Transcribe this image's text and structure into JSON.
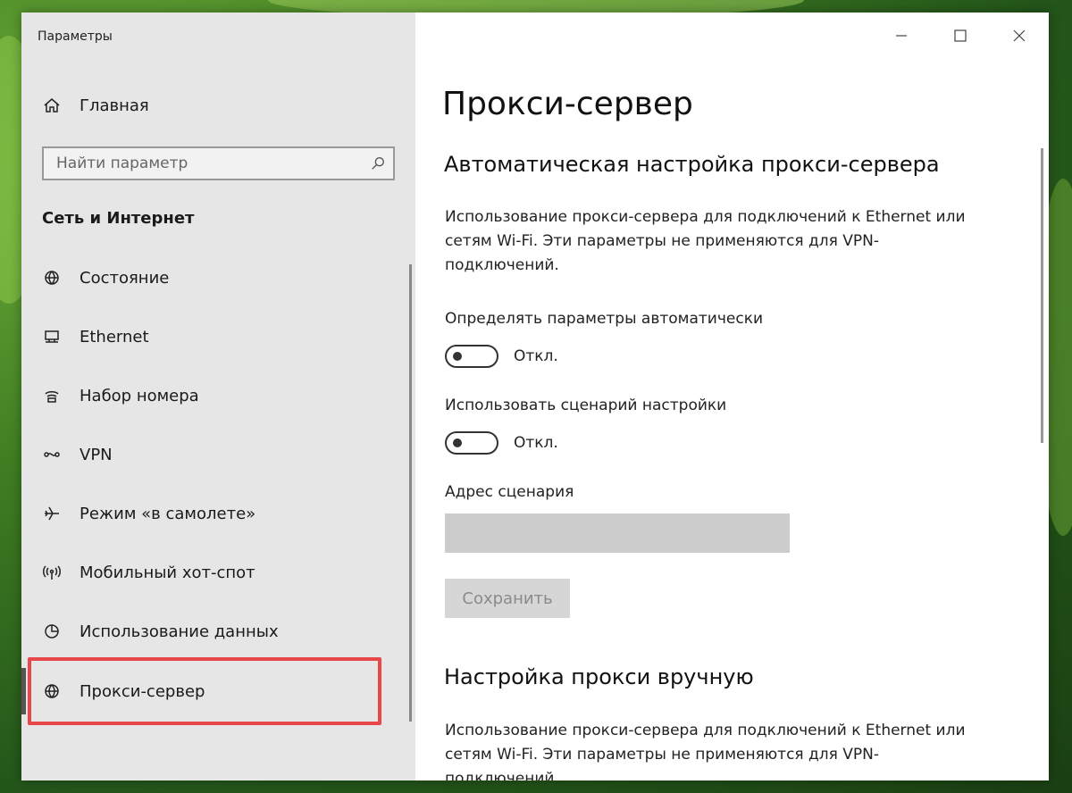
{
  "window": {
    "title": "Параметры",
    "controls": [
      "minimize",
      "maximize",
      "close"
    ]
  },
  "sidebar": {
    "home_label": "Главная",
    "search_placeholder": "Найти параметр",
    "section_header": "Сеть и Интернет",
    "items": [
      {
        "label": "Состояние",
        "icon": "globe-status-icon"
      },
      {
        "label": "Ethernet",
        "icon": "ethernet-icon"
      },
      {
        "label": "Набор номера",
        "icon": "dialup-icon"
      },
      {
        "label": "VPN",
        "icon": "vpn-icon"
      },
      {
        "label": "Режим «в самолете»",
        "icon": "airplane-icon"
      },
      {
        "label": "Мобильный хот-спот",
        "icon": "hotspot-icon"
      },
      {
        "label": "Использование данных",
        "icon": "data-usage-icon"
      },
      {
        "label": "Прокси-сервер",
        "icon": "globe-icon",
        "selected": true
      }
    ]
  },
  "main": {
    "page_title": "Прокси-сервер",
    "auto_section": {
      "heading": "Автоматическая настройка прокси-сервера",
      "description": "Использование прокси-сервера для подключений к Ethernet или сетям Wi-Fi. Эти параметры не применяются для VPN-подключений.",
      "detect_label": "Определять параметры автоматически",
      "detect_state": "Откл.",
      "script_label": "Использовать сценарий настройки",
      "script_state": "Откл.",
      "address_label": "Адрес сценария",
      "address_value": "",
      "save_label": "Сохранить"
    },
    "manual_section": {
      "heading": "Настройка прокси вручную",
      "description": "Использование прокси-сервера для подключений к Ethernet или сетям Wi-Fi. Эти параметры не применяются для VPN-подключений."
    }
  },
  "colors": {
    "sidebar_bg": "#e6e6e6",
    "highlight": "#e8474a",
    "disabled_input": "#cccccc"
  }
}
